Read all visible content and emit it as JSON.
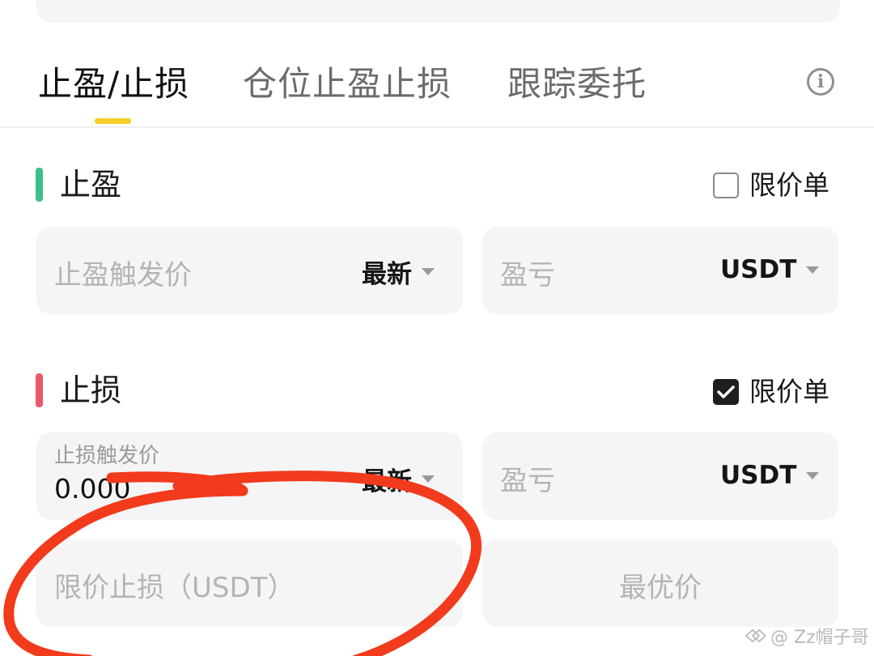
{
  "tabs": {
    "items": [
      {
        "label": "止盈/止损"
      },
      {
        "label": "仓位止盈止损"
      },
      {
        "label": "跟踪委托"
      }
    ],
    "active_index": 0,
    "info_icon": "info-icon"
  },
  "take_profit": {
    "title": "止盈",
    "accent_color": "#3dbf8a",
    "limit_order": {
      "label": "限价单",
      "checked": false
    },
    "trigger_field": {
      "placeholder": "止盈触发价",
      "source": "最新"
    },
    "pnl_field": {
      "placeholder": "盈亏",
      "unit": "USDT"
    }
  },
  "stop_loss": {
    "title": "止损",
    "accent_color": "#ea5a6a",
    "limit_order": {
      "label": "限价单",
      "checked": true
    },
    "trigger_field": {
      "label": "止损触发价",
      "value": "0.000",
      "source": "最新"
    },
    "pnl_field": {
      "placeholder": "盈亏",
      "unit": "USDT"
    },
    "limit_price_field": {
      "placeholder": "限价止损（USDT）"
    },
    "best_price_button": {
      "label": "最优价"
    }
  },
  "colors": {
    "tab_indicator": "#f5cf2a",
    "annotation_stroke": "#f23a1c",
    "field_background": "#f5f5f5"
  },
  "watermark": {
    "text": "@ Zz帽子哥"
  }
}
